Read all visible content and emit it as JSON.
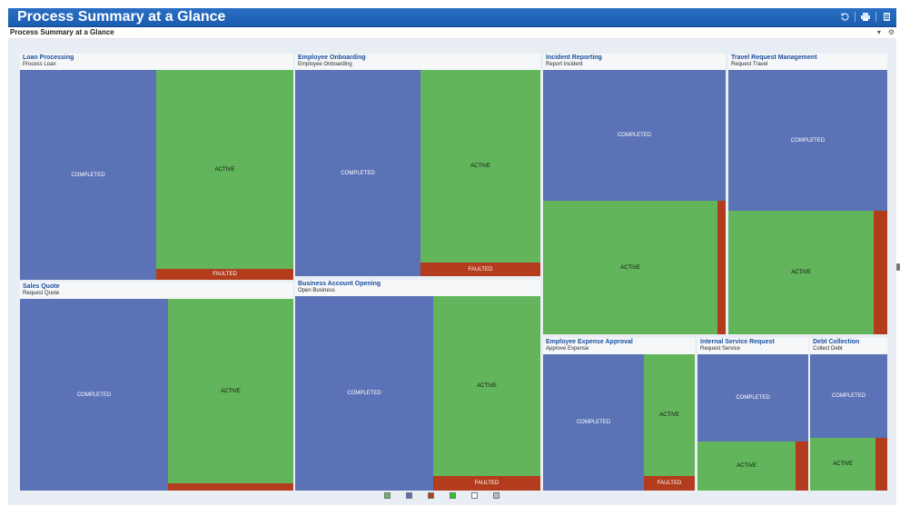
{
  "header": {
    "title": "Process Summary at a Glance",
    "tool_icons": [
      "refresh-icon",
      "print-icon",
      "menu-icon"
    ]
  },
  "subheader": {
    "title": "Process Summary at a Glance",
    "tool_icons": [
      "collapse-icon",
      "settings-icon"
    ]
  },
  "colors": {
    "completed": "#5b73b6",
    "active": "#63b55c",
    "faulted": "#b23c1c"
  },
  "status_labels": {
    "completed": "COMPLETED",
    "active": "ACTIVE",
    "faulted": "FAULTED"
  },
  "processes": [
    {
      "name": "Loan Processing",
      "activity": "Process Loan"
    },
    {
      "name": "Employee Onboarding",
      "activity": "Employee Onboarding"
    },
    {
      "name": "Incident Reporting",
      "activity": "Report Incident"
    },
    {
      "name": "Travel Request Management",
      "activity": "Request Travel"
    },
    {
      "name": "Sales Quote",
      "activity": "Request Quote"
    },
    {
      "name": "Business Account Opening",
      "activity": "Open Business"
    },
    {
      "name": "Employee Expense Approval",
      "activity": "Approve Expense"
    },
    {
      "name": "Internal Service Request",
      "activity": "Request Service"
    },
    {
      "name": "Debt Collection",
      "activity": "Collect Debt"
    }
  ],
  "legend": [
    {
      "color": "#63b55c"
    },
    {
      "color": "#5b73b6"
    },
    {
      "color": "#b23c1c"
    },
    {
      "color": "#22cc22"
    },
    {
      "color": "#ffffff"
    },
    {
      "color": "#bbbbbb"
    }
  ]
}
